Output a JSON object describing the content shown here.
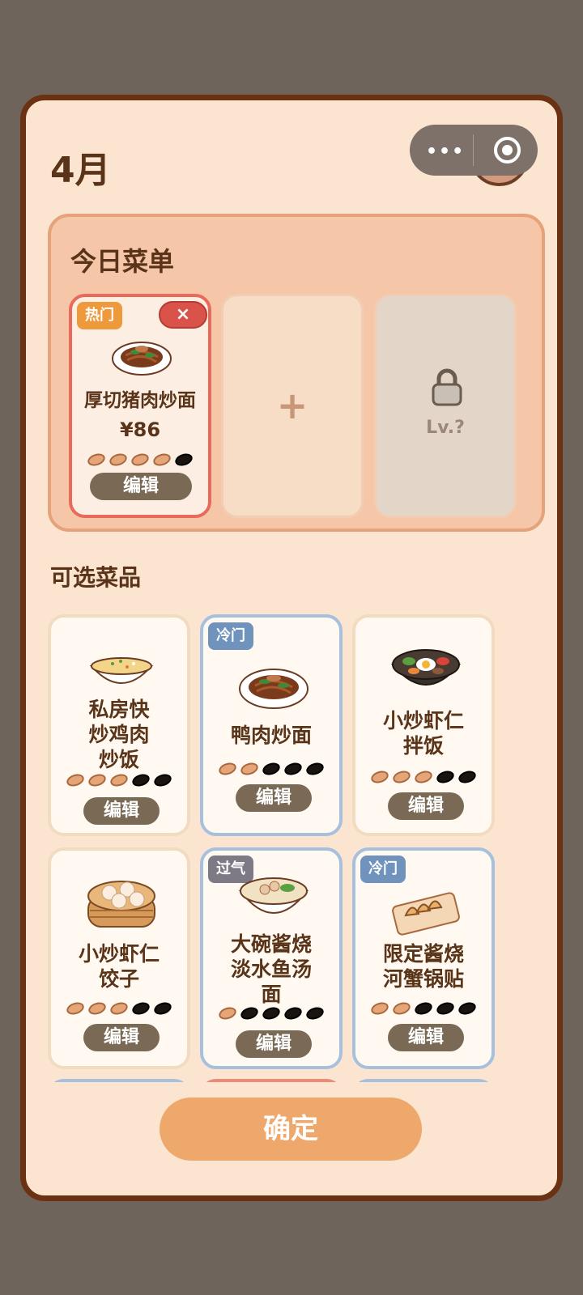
{
  "header": {
    "month": "4月"
  },
  "today_menu": {
    "title": "今日菜单",
    "slot": {
      "badge": "热门",
      "badge_color": "#ee9a3c",
      "remove_label": "×",
      "name": "厚切猪肉炒面",
      "price": "¥86",
      "rating": 4,
      "edit_label": "编辑"
    },
    "add_label": "+",
    "locked_label": "Lv.?"
  },
  "capsule": {
    "dots": "•••"
  },
  "available": {
    "title": "可选菜品",
    "dishes": [
      {
        "name": "私房快\n炒鸡肉\n炒饭",
        "rating": 3,
        "badge": "",
        "edit_label": "编辑",
        "icon": "fried-rice-icon"
      },
      {
        "name": "鸭肉炒面",
        "rating": 2,
        "badge": "冷门",
        "edit_label": "编辑",
        "icon": "noodles-icon"
      },
      {
        "name": "小炒虾仁\n拌饭",
        "rating": 3,
        "badge": "",
        "edit_label": "编辑",
        "icon": "bibimbap-icon"
      },
      {
        "name": "小炒虾仁\n饺子",
        "rating": 3,
        "badge": "",
        "edit_label": "编辑",
        "icon": "dumplings-icon"
      },
      {
        "name": "大碗酱烧\n淡水鱼汤\n面",
        "rating": 1,
        "badge": "过气",
        "edit_label": "编辑",
        "icon": "soup-icon"
      },
      {
        "name": "限定酱烧\n河蟹锅贴",
        "rating": 2,
        "badge": "冷门",
        "edit_label": "编辑",
        "icon": "potstickers-icon"
      }
    ],
    "badge_colors": {
      "冷门": "#6f93bd",
      "过气": "#7d7a86",
      "热门": "#ee9a3c"
    }
  },
  "confirm_label": "确定"
}
